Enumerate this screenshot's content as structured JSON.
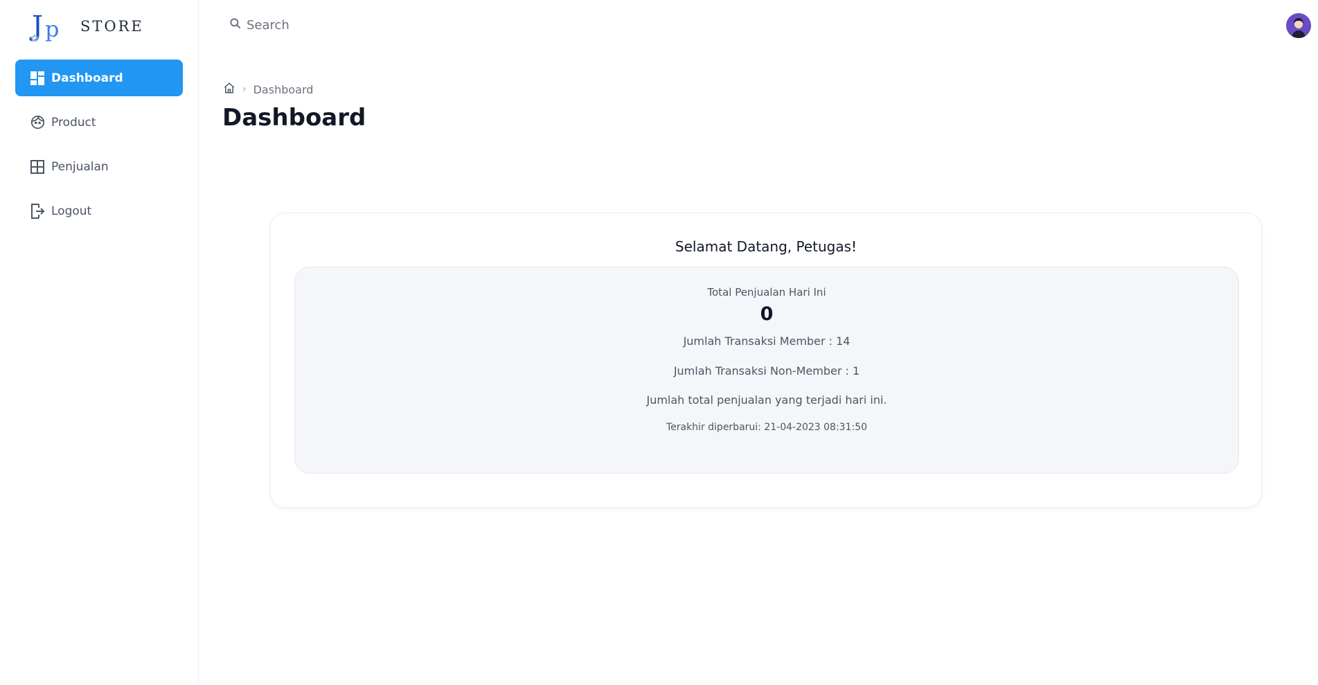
{
  "brand": {
    "logo": "JP",
    "name": "STORE"
  },
  "sidebar": {
    "items": [
      {
        "label": "Dashboard",
        "icon": "dashboard-icon",
        "active": true
      },
      {
        "label": "Product",
        "icon": "face-icon",
        "active": false
      },
      {
        "label": "Penjualan",
        "icon": "grid-icon",
        "active": false
      },
      {
        "label": "Logout",
        "icon": "logout-icon",
        "active": false
      }
    ]
  },
  "search": {
    "placeholder": "Search"
  },
  "breadcrumb": {
    "current": "Dashboard"
  },
  "page": {
    "title": "Dashboard"
  },
  "card": {
    "welcome": "Selamat Datang, Petugas!",
    "total_label": "Total Penjualan Hari Ini",
    "total_value": "0",
    "member_line": "Jumlah Transaksi Member : 14",
    "nonmember_line": "Jumlah Transaksi Non-Member : 1",
    "description": "Jumlah total penjualan yang terjadi hari ini.",
    "updated": "Terakhir diperbarui: 21-04-2023 08:31:50"
  },
  "colors": {
    "accent": "#2196f3",
    "avatar_bg": "#6b4bc4"
  }
}
